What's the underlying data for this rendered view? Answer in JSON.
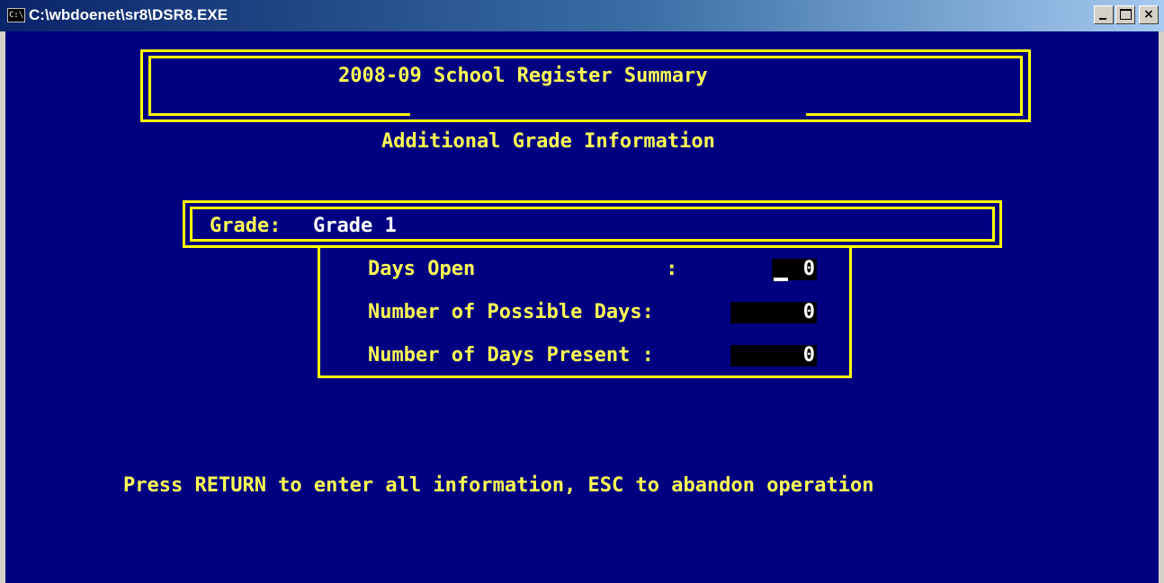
{
  "window": {
    "icon_label": "C:\\",
    "title": "C:\\wbdoenet\\sr8\\DSR8.EXE",
    "close_label": "×"
  },
  "screen": {
    "header_title": "2008-09 School Register Summary",
    "subtitle": "Additional Grade Information",
    "grade_label": "Grade:",
    "grade_value": "Grade 1",
    "fields": [
      {
        "label": "Days Open                :",
        "value": "0"
      },
      {
        "label": "Number of Possible Days:",
        "value": "0"
      },
      {
        "label": "Number of Days Present :",
        "value": "0"
      }
    ],
    "footer": "Press RETURN to enter all information, ESC to abandon operation"
  },
  "colors": {
    "background": "#000080",
    "frame": "#ffff00",
    "text": "#ffff55",
    "field_bg": "#000000",
    "field_text": "#ffffff"
  }
}
